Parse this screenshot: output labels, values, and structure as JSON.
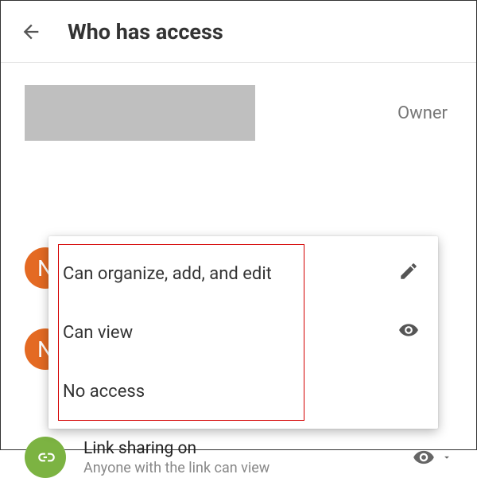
{
  "header": {
    "title": "Who has access"
  },
  "owner": {
    "role_label": "Owner"
  },
  "avatars": {
    "initial1": "N",
    "initial2": "N"
  },
  "menu": {
    "items": [
      {
        "label": "Can organize, add, and edit",
        "icon": "pencil"
      },
      {
        "label": "Can view",
        "icon": "eye"
      },
      {
        "label": "No access",
        "icon": ""
      }
    ]
  },
  "link_sharing": {
    "title": "Link sharing on",
    "subtitle": "Anyone with the link can view"
  }
}
